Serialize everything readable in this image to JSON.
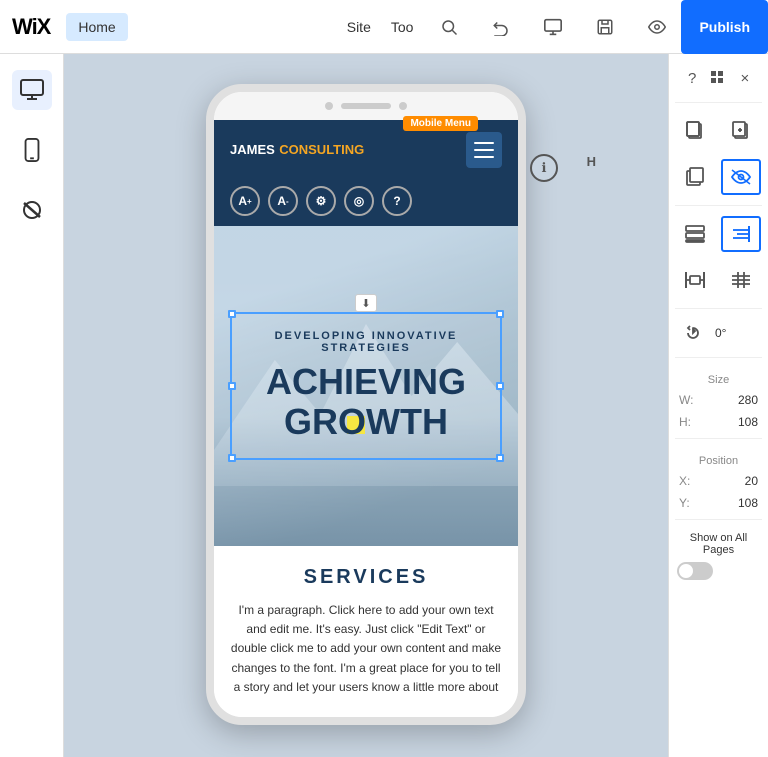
{
  "topbar": {
    "logo": "WiX",
    "home_label": "Home",
    "site_label": "Site",
    "tools_label": "Too",
    "publish_label": "Publish",
    "publish_color": "#116dff"
  },
  "left_sidebar": {
    "icons": [
      {
        "name": "desktop-icon",
        "symbol": "⬛",
        "active": true
      },
      {
        "name": "mobile-icon",
        "symbol": "📱",
        "active": false
      },
      {
        "name": "hide-icon",
        "symbol": "⊘",
        "active": false
      }
    ]
  },
  "phone": {
    "mobile_menu_badge": "Mobile Menu",
    "logo_prefix": "JAMES",
    "logo_suffix": " CONSULTING",
    "hero_subtitle": "DEVELOPING INNOVATIVE STRATEGIES",
    "hero_title_line1": "ACHIEVING",
    "hero_title_line2": "GROWTH",
    "services_title": "SERVICES",
    "services_text": "I'm a paragraph. Click here to add your own text and edit me. It's easy. Just click \"Edit Text\" or double click me to add your own content and make changes to the font. I'm a great place for you to tell a story and let your users know a little more about"
  },
  "right_panel": {
    "question_label": "?",
    "close_label": "×",
    "size_label": "Size",
    "width_label": "W:",
    "width_value": "280",
    "height_label": "H:",
    "height_value": "108",
    "position_label": "Position",
    "x_label": "X:",
    "x_value": "20",
    "y_label": "Y:",
    "y_value": "108",
    "show_all_pages_label": "Show on All Pages",
    "rotation_value": "0°"
  }
}
